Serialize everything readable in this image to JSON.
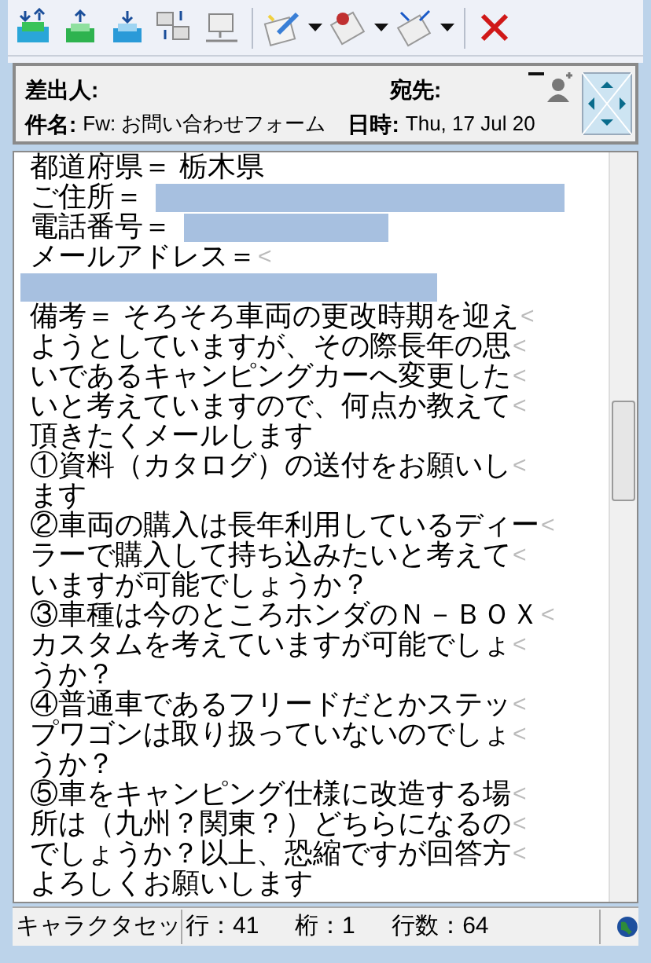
{
  "toolbar": {
    "buttons": [
      {
        "kind": "sendrecv"
      },
      {
        "kind": "send"
      },
      {
        "kind": "receive"
      },
      {
        "kind": "network"
      },
      {
        "kind": "offline"
      },
      {
        "kind": "compose",
        "dropdown": true
      },
      {
        "kind": "reply",
        "dropdown": true
      },
      {
        "kind": "forward",
        "dropdown": true
      },
      {
        "kind": "delete"
      }
    ]
  },
  "header": {
    "from_label": "差出人:",
    "to_label": "宛先:",
    "subject_label": "件名:",
    "subject": "Fw: お問い合わせフォーム",
    "date_label": "日時:",
    "date": "Thu, 17  Jul 20"
  },
  "body": {
    "lines": [
      {
        "text": "都道府県＝ 栃木県"
      },
      {
        "text": "ご住所＝",
        "redacted": true
      },
      {
        "text": "電話番号＝",
        "redacted": true
      },
      {
        "text": "メールアドレス＝",
        "wrap_mark": "<"
      },
      {
        "redacted": true
      },
      {
        "text": "備考＝ そろそろ車両の更改時期を迎え",
        "wrap_mark": "<"
      },
      {
        "text": "ようとしていますが、その際長年の思",
        "wrap_mark": "<"
      },
      {
        "text": "いであるキャンピングカーへ変更した",
        "wrap_mark": "<"
      },
      {
        "text": "いと考えていますので、何点か教えて",
        "wrap_mark": "<"
      },
      {
        "text": "頂きたくメールします"
      },
      {
        "text": "①資料（カタログ）の送付をお願いし",
        "wrap_mark": "<"
      },
      {
        "text": "ます"
      },
      {
        "text": "②車両の購入は長年利用しているディー",
        "wrap_mark": "<"
      },
      {
        "text": "ラーで購入して持ち込みたいと考えて",
        "wrap_mark": "<"
      },
      {
        "text": "いますが可能でしょうか？"
      },
      {
        "text": "③車種は今のところホンダのＮ－ＢＯＸ",
        "wrap_mark": "<"
      },
      {
        "text": "カスタムを考えていますが可能でしょ",
        "wrap_mark": "<"
      },
      {
        "text": "うか？"
      },
      {
        "text": "④普通車であるフリードだとかステッ",
        "wrap_mark": "<"
      },
      {
        "text": "プワゴンは取り扱っていないのでしょ",
        "wrap_mark": "<"
      },
      {
        "text": "うか？"
      },
      {
        "text": "⑤車をキャンピング仕様に改造する場",
        "wrap_mark": "<"
      },
      {
        "text": "所は（九州？関東？）どちらになるの",
        "wrap_mark": "<"
      },
      {
        "text": "でしょうか？以上、恐縮ですが回答方",
        "wrap_mark": "<"
      },
      {
        "text": "よろしくお願いします"
      }
    ]
  },
  "status_bar": {
    "charset": "キャラクタセッ",
    "line": "行：41",
    "column": "桁：1",
    "line_count": "行数：64"
  }
}
